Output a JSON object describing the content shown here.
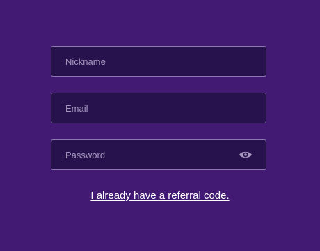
{
  "form": {
    "nickname": {
      "placeholder": "Nickname",
      "value": ""
    },
    "email": {
      "placeholder": "Email",
      "value": ""
    },
    "password": {
      "placeholder": "Password",
      "value": "",
      "toggle_icon": "eye-icon"
    }
  },
  "referral_link": {
    "label": "I already have a referral code."
  },
  "colors": {
    "background": "#421a73",
    "field_background": "#28124d",
    "field_border": "#8d79b0",
    "placeholder": "#a597be",
    "link": "#ffffff"
  }
}
